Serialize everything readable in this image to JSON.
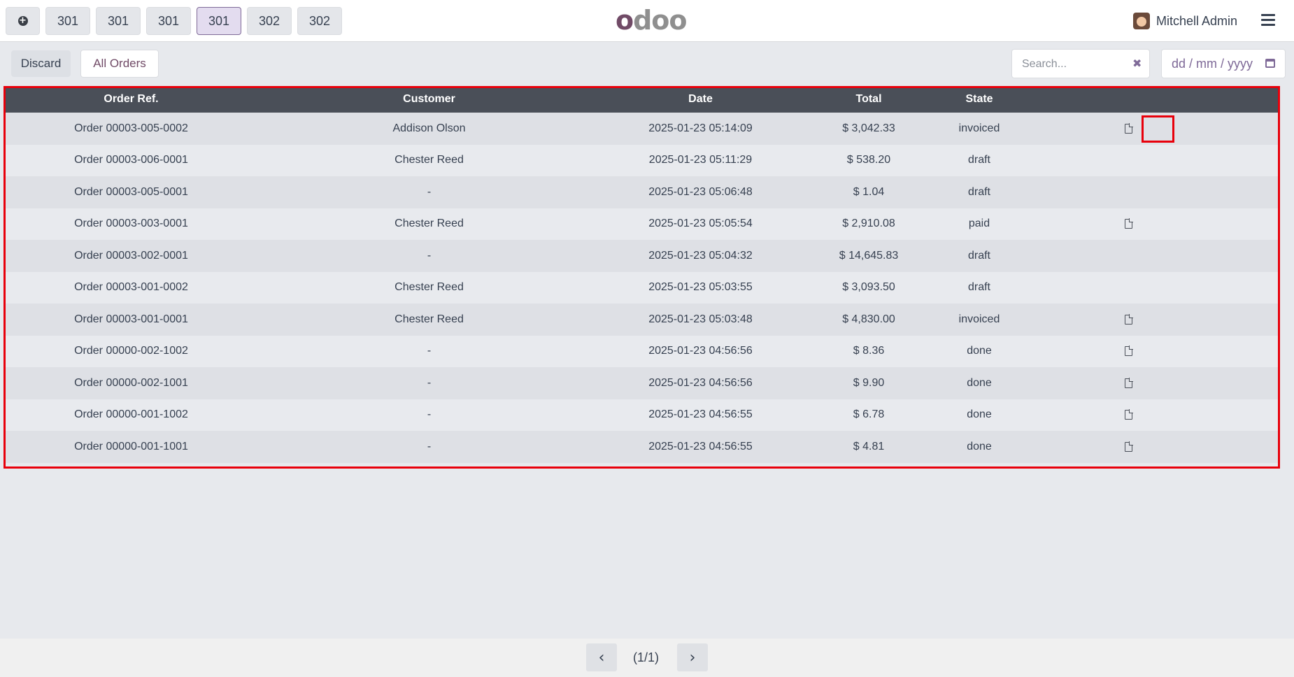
{
  "navbar": {
    "order_tabs": [
      {
        "label": "301",
        "active": false
      },
      {
        "label": "301",
        "active": false
      },
      {
        "label": "301",
        "active": false
      },
      {
        "label": "301",
        "active": true
      },
      {
        "label": "302",
        "active": false
      },
      {
        "label": "302",
        "active": false
      }
    ],
    "logo_first": "o",
    "logo_rest": "doo",
    "user_name": "Mitchell Admin"
  },
  "controls": {
    "discard_label": "Discard",
    "filter_label": "All Orders",
    "search_placeholder": "Search...",
    "date_placeholder": "dd / mm / yyyy"
  },
  "table": {
    "headers": [
      "Order Ref.",
      "Customer",
      "Date",
      "Total",
      "State",
      ""
    ],
    "rows": [
      {
        "ref": "Order 00003-005-0002",
        "customer": "Addison Olson",
        "date": "2025-01-23 05:14:09",
        "total": "$ 3,042.33",
        "state": "invoiced",
        "has_invoice": true
      },
      {
        "ref": "Order 00003-006-0001",
        "customer": "Chester Reed",
        "date": "2025-01-23 05:11:29",
        "total": "$ 538.20",
        "state": "draft",
        "has_invoice": false
      },
      {
        "ref": "Order 00003-005-0001",
        "customer": "-",
        "date": "2025-01-23 05:06:48",
        "total": "$ 1.04",
        "state": "draft",
        "has_invoice": false
      },
      {
        "ref": "Order 00003-003-0001",
        "customer": "Chester Reed",
        "date": "2025-01-23 05:05:54",
        "total": "$ 2,910.08",
        "state": "paid",
        "has_invoice": true
      },
      {
        "ref": "Order 00003-002-0001",
        "customer": "-",
        "date": "2025-01-23 05:04:32",
        "total": "$ 14,645.83",
        "state": "draft",
        "has_invoice": false
      },
      {
        "ref": "Order 00003-001-0002",
        "customer": "Chester Reed",
        "date": "2025-01-23 05:03:55",
        "total": "$ 3,093.50",
        "state": "draft",
        "has_invoice": false
      },
      {
        "ref": "Order 00003-001-0001",
        "customer": "Chester Reed",
        "date": "2025-01-23 05:03:48",
        "total": "$ 4,830.00",
        "state": "invoiced",
        "has_invoice": true
      },
      {
        "ref": "Order 00000-002-1002",
        "customer": "-",
        "date": "2025-01-23 04:56:56",
        "total": "$ 8.36",
        "state": "done",
        "has_invoice": true
      },
      {
        "ref": "Order 00000-002-1001",
        "customer": "-",
        "date": "2025-01-23 04:56:56",
        "total": "$ 9.90",
        "state": "done",
        "has_invoice": true
      },
      {
        "ref": "Order 00000-001-1002",
        "customer": "-",
        "date": "2025-01-23 04:56:55",
        "total": "$ 6.78",
        "state": "done",
        "has_invoice": true
      },
      {
        "ref": "Order 00000-001-1001",
        "customer": "-",
        "date": "2025-01-23 04:56:55",
        "total": "$ 4.81",
        "state": "done",
        "has_invoice": true
      }
    ]
  },
  "pager": {
    "text": "(1/1)",
    "prev_glyph": "‹",
    "next_glyph": "›"
  },
  "colors": {
    "brand": "#714b67",
    "header_bg": "#4a4f58",
    "highlight": "#e8000b"
  },
  "icons": {
    "add": "plus-circle-icon",
    "menu": "hamburger-icon",
    "clear": "close-icon",
    "calendar": "calendar-icon",
    "invoice": "file-icon"
  }
}
